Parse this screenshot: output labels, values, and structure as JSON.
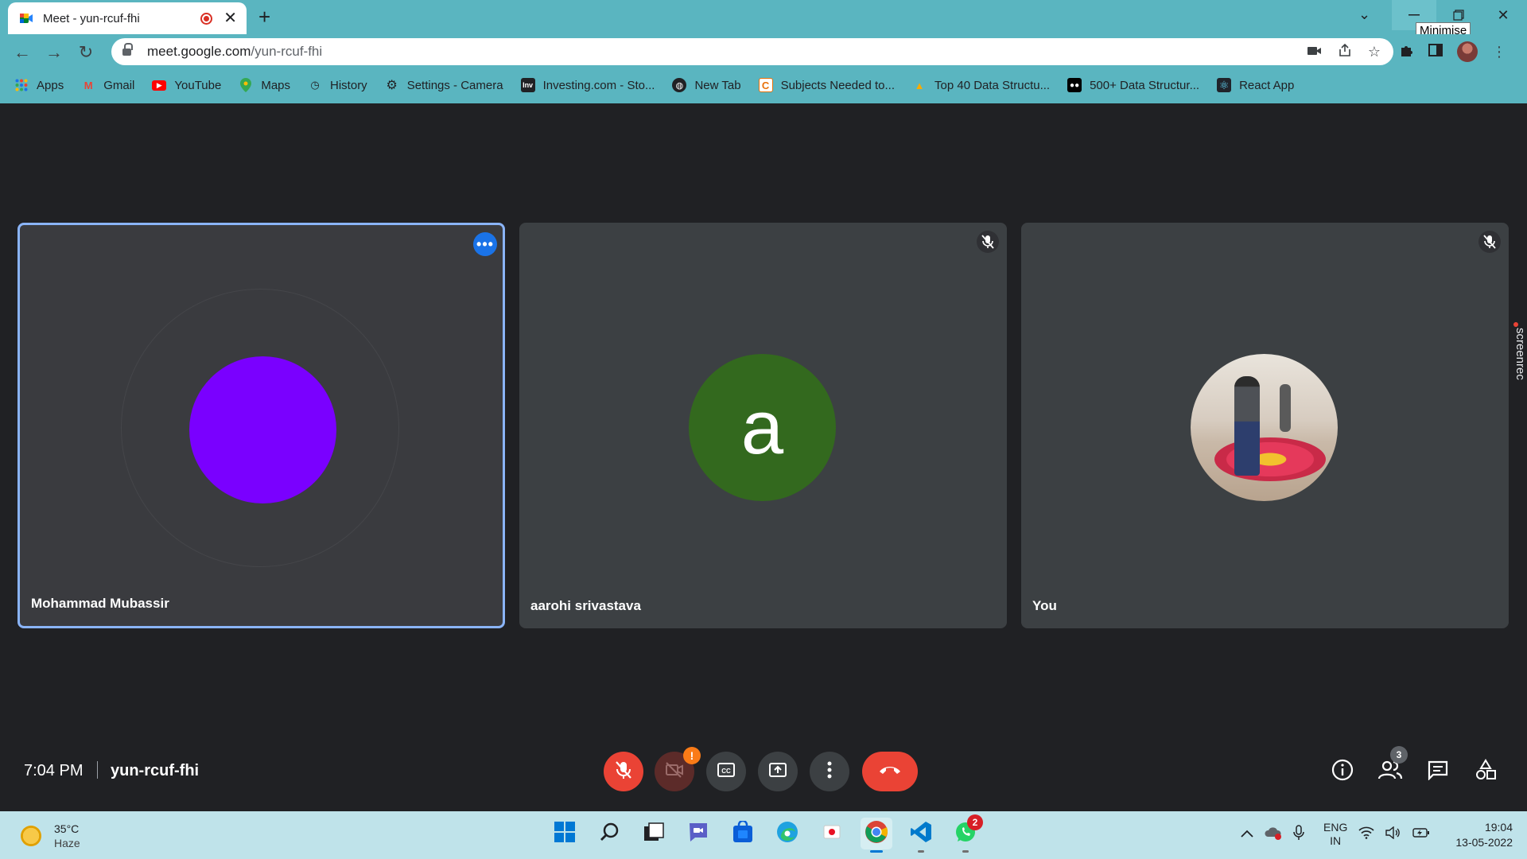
{
  "browser": {
    "tab_title": "Meet - yun-rcuf-fhi",
    "url_host": "meet.google.com",
    "url_path": "/yun-rcuf-fhi",
    "tooltip": "Minimise",
    "bookmarks": [
      {
        "label": "Apps",
        "icon": "apps-grid-icon"
      },
      {
        "label": "Gmail",
        "icon": "gmail-icon"
      },
      {
        "label": "YouTube",
        "icon": "youtube-icon"
      },
      {
        "label": "Maps",
        "icon": "maps-pin-icon"
      },
      {
        "label": "History",
        "icon": "history-icon"
      },
      {
        "label": "Settings - Camera",
        "icon": "gear-icon"
      },
      {
        "label": "Investing.com - Sto...",
        "icon": "investing-icon"
      },
      {
        "label": "New Tab",
        "icon": "globe-icon"
      },
      {
        "label": "Subjects Needed to...",
        "icon": "bookmark-doc-icon"
      },
      {
        "label": "Top 40 Data Structu...",
        "icon": "bookmark-site-icon"
      },
      {
        "label": "500+ Data Structur...",
        "icon": "medium-icon"
      },
      {
        "label": "React App",
        "icon": "react-icon"
      }
    ]
  },
  "meet": {
    "participants": [
      {
        "name": "Mohammad Mubassir",
        "avatar_color": "#7a00ff",
        "avatar_letter": ""
      },
      {
        "name": "aarohi srivastava",
        "avatar_color": "#33691e",
        "avatar_letter": "a"
      },
      {
        "name": "You",
        "avatar_color": "",
        "avatar_letter": ""
      }
    ],
    "time": "7:04 PM",
    "meeting_code": "yun-rcuf-fhi",
    "participant_count": "3",
    "camera_warning": "!",
    "overlay_brand": "screenrec"
  },
  "taskbar": {
    "weather_temp": "35°C",
    "weather_desc": "Haze",
    "lang_line1": "ENG",
    "lang_line2": "IN",
    "clock_time": "19:04",
    "clock_date": "13-05-2022",
    "whatsapp_badge": "2"
  },
  "colors": {
    "chrome_bg": "#5ab5c0",
    "meet_bg": "#202124",
    "tile_bg": "#3c4043",
    "active_border": "#8ab4f8",
    "danger": "#ea4335"
  }
}
